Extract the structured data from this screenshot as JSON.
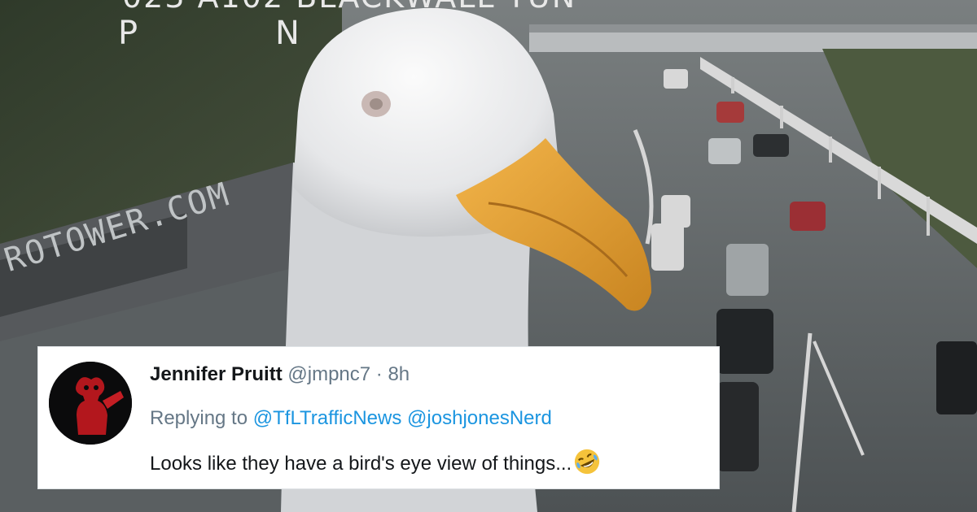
{
  "camera_overlay": {
    "top_text": "023 A102 BLACKWALL TUN",
    "letter_left": "P",
    "letter_right": "N",
    "wall_sign": "ROTOWER.COM"
  },
  "tweet": {
    "name": "Jennifer Pruitt",
    "handle": "@jmpnc7",
    "separator": "·",
    "time": "8h",
    "replying_prefix": "Replying to",
    "mentions": [
      "@TfLTrafficNews",
      "@joshjonesNerd"
    ],
    "text": "Looks like they have a bird's eye view of things...",
    "emoji_icon": "rolling-on-floor-laughing-icon"
  },
  "colors": {
    "mention_blue": "#1b95e0",
    "secondary_gray": "#657786",
    "gull_beak": "#e9a23a"
  }
}
